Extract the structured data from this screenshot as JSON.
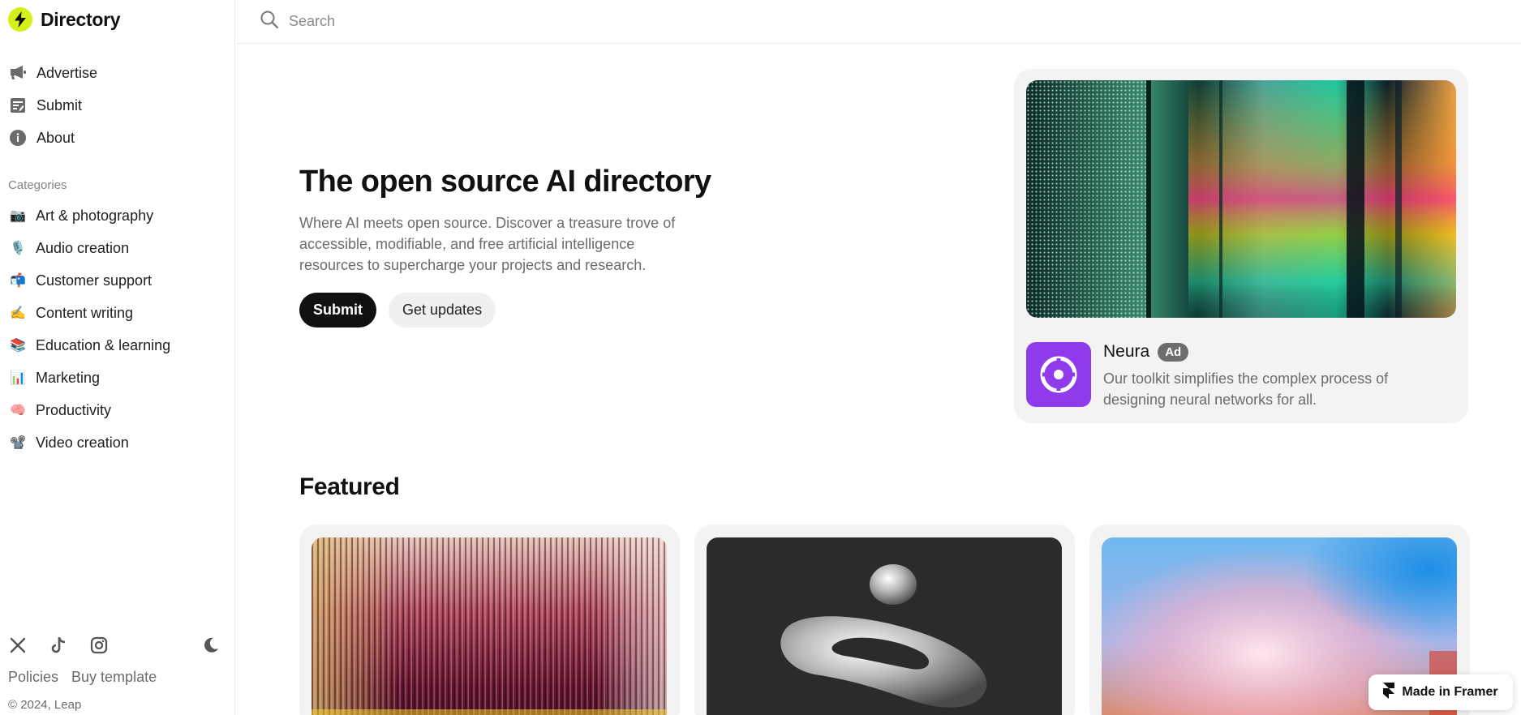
{
  "brand": {
    "title": "Directory",
    "accent": "#d4f018"
  },
  "nav": {
    "items": [
      {
        "label": "Advertise",
        "icon": "megaphone-icon"
      },
      {
        "label": "Submit",
        "icon": "edit-form-icon"
      },
      {
        "label": "About",
        "icon": "info-icon"
      }
    ]
  },
  "categories": {
    "heading": "Categories",
    "items": [
      {
        "label": "Art & photography",
        "emoji": "📷"
      },
      {
        "label": "Audio creation",
        "emoji": "🎙️"
      },
      {
        "label": "Customer support",
        "emoji": "📬"
      },
      {
        "label": "Content writing",
        "emoji": "✍️"
      },
      {
        "label": "Education & learning",
        "emoji": "📚"
      },
      {
        "label": "Marketing",
        "emoji": "📊"
      },
      {
        "label": "Productivity",
        "emoji": "🧠"
      },
      {
        "label": "Video creation",
        "emoji": "📽️"
      }
    ]
  },
  "footer": {
    "socials": [
      "x-icon",
      "tiktok-icon",
      "instagram-icon"
    ],
    "theme_icon": "moon-icon",
    "links": [
      "Policies",
      "Buy template"
    ],
    "copyright": "© 2024, Leap"
  },
  "search": {
    "placeholder": "Search",
    "value": ""
  },
  "hero": {
    "title": "The open source AI directory",
    "description": "Where AI meets open source. Discover a treasure trove of accessible, modifiable, and free artificial intelligence resources to supercharge your projects and research.",
    "primary_button": "Submit",
    "secondary_button": "Get updates"
  },
  "ad": {
    "name": "Neura",
    "badge": "Ad",
    "description": "Our toolkit simplifies the complex process of designing neural networks for all.",
    "logo_color": "#8f3bec"
  },
  "featured": {
    "title": "Featured"
  },
  "framer": {
    "label": "Made in Framer"
  }
}
